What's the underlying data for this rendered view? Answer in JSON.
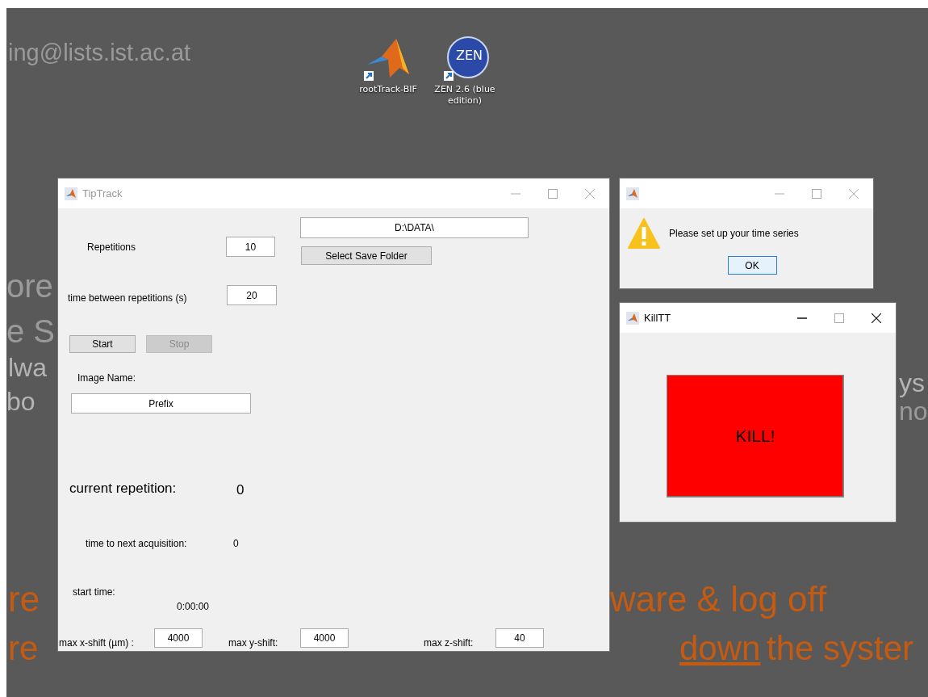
{
  "wallpaper_texts": [
    {
      "text": "ing@lists.ist.ac.at",
      "color": "#9a9a9a",
      "underlined": false
    },
    {
      "text": "ore",
      "color": "#9a9a9a",
      "underlined": false
    },
    {
      "text": "e S",
      "color": "#9a9a9a",
      "underlined": false
    },
    {
      "text": "lwa",
      "color": "#b4b4b4",
      "underlined": false
    },
    {
      "text": "bo",
      "color": "#b4b4b4",
      "underlined": false
    },
    {
      "text": "ys",
      "color": "#b4b4b4",
      "underlined": false
    },
    {
      "text": "no",
      "color": "#9a9a9a",
      "underlined": false
    },
    {
      "text": "re",
      "color": "#c55a11",
      "underlined": false
    },
    {
      "text": "ware & log off",
      "color": "#c55a11",
      "underlined": false
    },
    {
      "text": "re",
      "color": "#c55a11",
      "underlined": false
    },
    {
      "text": "down",
      "color": "#c55a11",
      "underlined": true
    },
    {
      "text": "the syster",
      "color": "#c55a11",
      "underlined": false
    }
  ],
  "desktop_icons": [
    {
      "label": "rootTrack-BIF",
      "kind": "matlab"
    },
    {
      "label": "ZEN 2.6 (blue edition)",
      "kind": "zen",
      "badge": "ZEN"
    }
  ],
  "tiptrack": {
    "title": "TipTrack",
    "active": false,
    "save_path": "D:\\DATA\\",
    "select_folder_button": "Select Save Folder",
    "repetitions_label": "Repetitions",
    "repetitions": "10",
    "interval_label": "time between repetitions (s)",
    "interval": "20",
    "buttons": [
      {
        "label": "Start",
        "disabled": false
      },
      {
        "label": "Stop",
        "disabled": true
      }
    ],
    "image_name_label": "Image Name:",
    "image_name": "Prefix",
    "current_repetition_label": "current repetition:",
    "current_repetition": "0",
    "next_acquisition_label": "time to next acquisition:",
    "next_acquisition": "0",
    "start_time_label": "start time:",
    "start_time": "0:00:00",
    "shifts": [
      {
        "label": "max x-shift (µm) :",
        "value": "4000"
      },
      {
        "label": "max y-shift:",
        "value": "4000"
      },
      {
        "label": "max z-shift:",
        "value": "40"
      }
    ]
  },
  "dialog": {
    "active": false,
    "message": "Please set up your time series",
    "button": "OK"
  },
  "kill_window": {
    "title": "KillTT",
    "active": true,
    "button": "KILL!"
  }
}
